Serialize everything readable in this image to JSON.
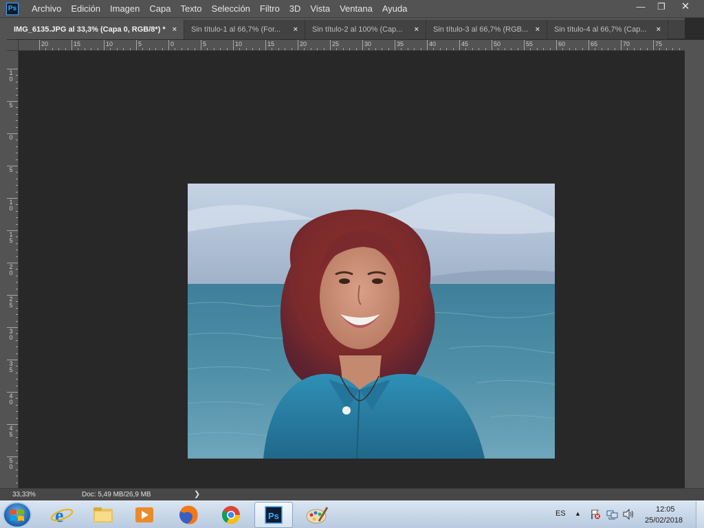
{
  "app": {
    "logo": "Ps",
    "menu": [
      "Archivo",
      "Edición",
      "Imagen",
      "Capa",
      "Texto",
      "Selección",
      "Filtro",
      "3D",
      "Vista",
      "Ventana",
      "Ayuda"
    ],
    "window_buttons": {
      "minimize": "—",
      "maximize": "❐",
      "close": "✕"
    }
  },
  "tabs": [
    {
      "label": "IMG_6135.JPG al 33,3% (Capa 0, RGB/8*) *",
      "close": "×",
      "active": true
    },
    {
      "label": "Sin título-1 al 66,7% (For...",
      "close": "×",
      "active": false
    },
    {
      "label": "Sin título-2 al 100% (Cap...",
      "close": "×",
      "active": false
    },
    {
      "label": "Sin título-3 al 66,7% (RGB...",
      "close": "×",
      "active": false
    },
    {
      "label": "Sin título-4 al 66,7% (Cap...",
      "close": "×",
      "active": false
    }
  ],
  "ruler_h_labels": [
    "20",
    "15",
    "10",
    "5",
    "0",
    "5",
    "10",
    "15",
    "20",
    "25",
    "30",
    "35",
    "40",
    "45",
    "50",
    "55",
    "60",
    "65",
    "70",
    "75"
  ],
  "ruler_v_labels": [
    "1 0",
    "5",
    "0",
    "5",
    "1 0",
    "1 5",
    "2 0",
    "2 5",
    "3 0",
    "3 5",
    "4 0",
    "4 5",
    "5 0"
  ],
  "status": {
    "zoom": "33,33%",
    "doc": "Doc: 5,49 MB/26,9 MB",
    "arrow": "❯"
  },
  "taskbar": {
    "apps": [
      "internet-explorer",
      "file-explorer",
      "media-player",
      "firefox",
      "chrome",
      "photoshop",
      "paint"
    ],
    "active_app": "photoshop",
    "language": "ES",
    "tray_up": "▲",
    "time": "12:05",
    "date": "25/02/2018"
  },
  "colors": {
    "ui_dark": "#535353",
    "canvas_bg": "#282828",
    "ps_blue": "#3fa6ff",
    "shirt_teal": "#2a7ea3",
    "sea_teal": "#4d8fa6"
  }
}
